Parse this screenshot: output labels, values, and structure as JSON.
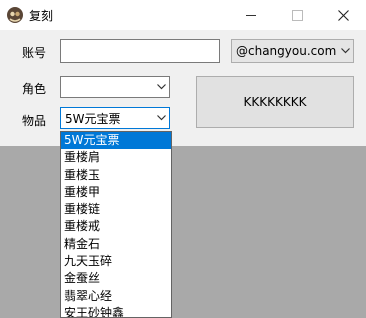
{
  "window": {
    "title": "复刻",
    "app_icon": "app-logo-icon"
  },
  "form": {
    "account_label": "账号",
    "account_value": "",
    "domain_value": "@changyou.com",
    "role_label": "角色",
    "role_value": "",
    "item_label": "物品",
    "item_value": "5W元宝票",
    "action_button_label": "KKKKKKKK"
  },
  "dropdown": {
    "options": [
      "5W元宝票",
      "重楼肩",
      "重楼玉",
      "重楼甲",
      "重楼链",
      "重楼戒",
      "精金石",
      "九天玉碎",
      "金蚕丝",
      "翡翠心经",
      "安王砂钟鑫"
    ],
    "selected_index": 0
  },
  "colors": {
    "selection": "#0078d7",
    "desktop_background": "#a9a9a9",
    "window_background": "#f0f0f0"
  }
}
